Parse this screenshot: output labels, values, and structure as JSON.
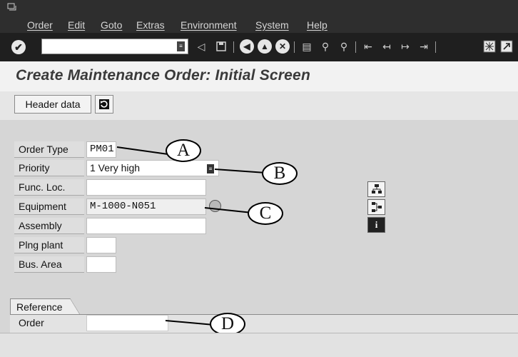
{
  "menu": {
    "items": [
      {
        "label": "Order"
      },
      {
        "label": "Edit"
      },
      {
        "label": "Goto"
      },
      {
        "label": "Extras"
      },
      {
        "label": "Environment"
      },
      {
        "label": "System"
      },
      {
        "label": "Help"
      }
    ]
  },
  "toolbar": {
    "command_field_value": "",
    "icons": [
      "enter-icon",
      "back-icon",
      "save-icon",
      "back-nav-icon",
      "exit-icon",
      "cancel-icon",
      "print-icon",
      "find-icon",
      "find-next-icon",
      "first-page-icon",
      "prev-page-icon",
      "next-page-icon",
      "last-page-icon",
      "new-session-icon",
      "shortcut-icon"
    ]
  },
  "page": {
    "title": "Create Maintenance Order: Initial Screen"
  },
  "app_toolbar": {
    "header_data_label": "Header data"
  },
  "form": {
    "fields": [
      {
        "label": "Order Type",
        "value": "PM01"
      },
      {
        "label": "Priority",
        "value": "1 Very high"
      },
      {
        "label": "Func. Loc.",
        "value": ""
      },
      {
        "label": "Equipment",
        "value": "M-1000-N051"
      },
      {
        "label": "Assembly",
        "value": ""
      },
      {
        "label": "Plng plant",
        "value": ""
      },
      {
        "label": "Bus. Area",
        "value": ""
      }
    ]
  },
  "reference": {
    "tab_label": "Reference",
    "order_label": "Order",
    "order_value": ""
  },
  "callouts": [
    "A",
    "B",
    "C",
    "D"
  ],
  "colors": {
    "menubar_bg": "#2e2e2e",
    "toolbar_bg": "#1f1f1f",
    "form_bg": "#d6d6d6",
    "title_text": "#3a3a3a"
  }
}
